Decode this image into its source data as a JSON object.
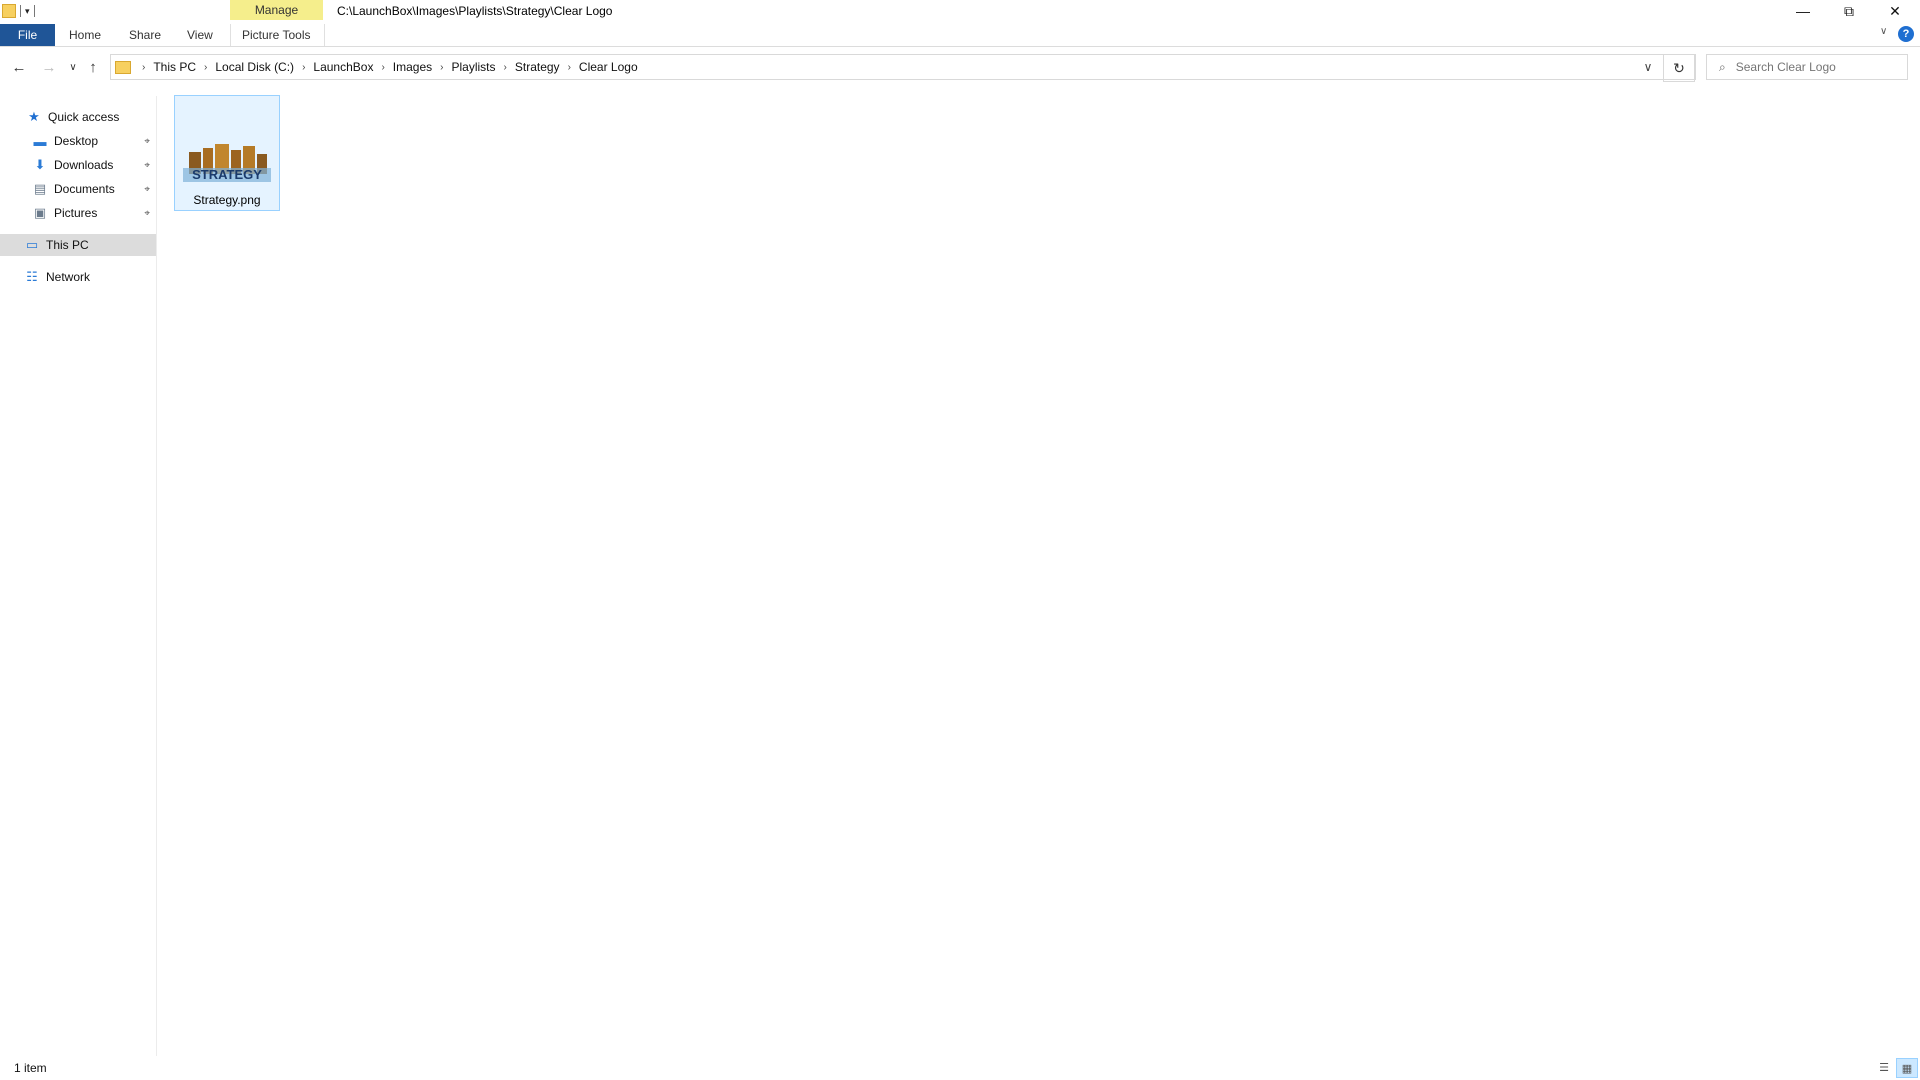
{
  "window": {
    "title": "C:\\LaunchBox\\Images\\Playlists\\Strategy\\Clear Logo",
    "minimize_glyph": "—",
    "maximize_glyph": "⧉",
    "close_glyph": "✕"
  },
  "ribbon": {
    "contextual_group": "Manage",
    "tabs": [
      {
        "label": "File"
      },
      {
        "label": "Home"
      },
      {
        "label": "Share"
      },
      {
        "label": "View"
      },
      {
        "label": "Picture Tools"
      }
    ],
    "help_glyph": "?",
    "expand_glyph": "∨"
  },
  "navigation": {
    "back_glyph": "←",
    "forward_glyph": "→",
    "recent_glyph": "∨",
    "up_glyph": "↑",
    "breadcrumb": [
      "This PC",
      "Local Disk (C:)",
      "LaunchBox",
      "Images",
      "Playlists",
      "Strategy",
      "Clear Logo"
    ],
    "separator": "›",
    "dropdown_glyph": "∨",
    "refresh_glyph": "↻"
  },
  "search": {
    "placeholder": "Search Clear Logo",
    "icon": "search-icon",
    "glyph": "⌕"
  },
  "sidebar": {
    "items": [
      {
        "label": "Quick access",
        "icon": "star-icon",
        "glyph": "★",
        "color": "#1f6fd1"
      },
      {
        "label": "Desktop",
        "icon": "desktop-icon",
        "glyph": "▬",
        "color": "#2b7bd6",
        "pinned": true
      },
      {
        "label": "Downloads",
        "icon": "download-icon",
        "glyph": "⬇",
        "color": "#2b7bd6",
        "pinned": true
      },
      {
        "label": "Documents",
        "icon": "documents-icon",
        "glyph": "▤",
        "color": "#6b7b8c",
        "pinned": true
      },
      {
        "label": "Pictures",
        "icon": "pictures-icon",
        "glyph": "▣",
        "color": "#6b7b8c",
        "pinned": true
      },
      {
        "label": "This PC",
        "icon": "computer-icon",
        "glyph": "▭",
        "color": "#2b7bd6"
      },
      {
        "label": "Network",
        "icon": "network-icon",
        "glyph": "☷",
        "color": "#2b7bd6"
      }
    ],
    "pin_glyph": "⌖"
  },
  "files": [
    {
      "name": "Strategy.png",
      "thumbnail_text": "STRATEGY"
    }
  ],
  "status": {
    "item_count": "1 item",
    "details_view_glyph": "☰",
    "large_icons_glyph": "▦"
  },
  "colors": {
    "file_tab": "#1f5597",
    "manage_tab": "#f5ee8c",
    "selection": "#e5f3ff",
    "selection_border": "#99d1ff"
  }
}
